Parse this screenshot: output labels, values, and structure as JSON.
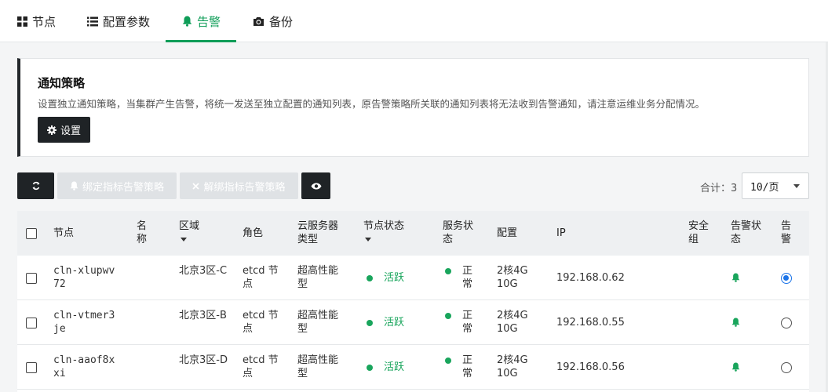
{
  "tabs": [
    {
      "label": "节点",
      "icon": "grid-icon"
    },
    {
      "label": "配置参数",
      "icon": "list-icon"
    },
    {
      "label": "告警",
      "icon": "bell-icon",
      "active": true
    },
    {
      "label": "备份",
      "icon": "camera-icon"
    }
  ],
  "notice": {
    "title": "通知策略",
    "description": "设置独立通知策略，当集群产生告警，将统一发送至独立配置的通知列表，原告警策略所关联的通知列表将无法收到告警通知，请注意运维业务分配情况。",
    "button_label": "设置"
  },
  "toolbar": {
    "bind_label": "绑定指标告警策略",
    "unbind_label": "解绑指标告警策略",
    "total_text": "合计：3",
    "page_size": "10/页"
  },
  "table": {
    "headers": {
      "node": "节点",
      "name": "名称",
      "zone": "区域",
      "role": "角色",
      "server_type": "云服务器类型",
      "node_status": "节点状态",
      "service_status": "服务状态",
      "config": "配置",
      "ip": "IP",
      "security_group": "安全组",
      "alert_status": "告警状态",
      "alert": "告警"
    },
    "rows": [
      {
        "node": "cln-xlupwv72",
        "name": "",
        "zone": "北京3区-C",
        "role": "etcd 节点",
        "server_type": "超高性能型",
        "node_status": "活跃",
        "service_status": "正常",
        "config": "2核4G 10G",
        "ip": "192.168.0.62",
        "security_group": "",
        "alert_selected": true
      },
      {
        "node": "cln-vtmer3je",
        "name": "",
        "zone": "北京3区-B",
        "role": "etcd 节点",
        "server_type": "超高性能型",
        "node_status": "活跃",
        "service_status": "正常",
        "config": "2核4G 10G",
        "ip": "192.168.0.55",
        "security_group": "",
        "alert_selected": false
      },
      {
        "node": "cln-aaof8xxi",
        "name": "",
        "zone": "北京3区-D",
        "role": "etcd 节点",
        "server_type": "超高性能型",
        "node_status": "活跃",
        "service_status": "正常",
        "config": "2核4G 10G",
        "ip": "192.168.0.56",
        "security_group": "",
        "alert_selected": false
      }
    ]
  },
  "colors": {
    "accent": "#0f9d58",
    "status_green": "#19a55c",
    "dark_button": "#1f2326",
    "radio_blue": "#1a73e8"
  }
}
